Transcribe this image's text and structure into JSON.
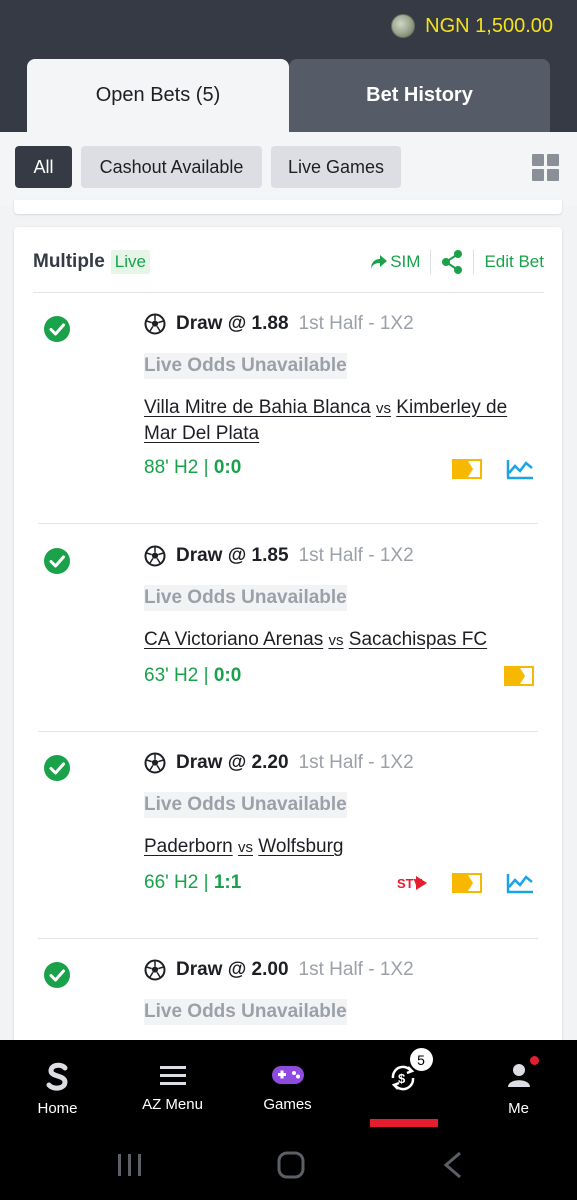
{
  "header": {
    "balance": "NGN 1,500.00",
    "tabs": [
      {
        "label": "Open Bets (5)",
        "active": true
      },
      {
        "label": "Bet History",
        "active": false
      }
    ]
  },
  "filters": {
    "chips": [
      "All",
      "Cashout Available",
      "Live Games"
    ],
    "active": "All",
    "layout_icon": "grid-icon"
  },
  "bet": {
    "type": "Multiple",
    "live_label": "Live",
    "sim_label": "SIM",
    "edit_label": "Edit Bet",
    "selections": [
      {
        "pick": "Draw @ 1.88",
        "market": "1st Half - 1X2",
        "odds_status": "Live Odds Unavailable",
        "home": "Villa Mitre de Bahia Blanca",
        "away": "Kimberley de Mar Del Plata",
        "vs": "vs",
        "time": "88' H2 | ",
        "score": "0:0",
        "icons": [
          "live-match-tracker-icon",
          "stats-icon"
        ]
      },
      {
        "pick": "Draw @ 1.85",
        "market": "1st Half - 1X2",
        "odds_status": "Live Odds Unavailable",
        "home": "CA Victoriano Arenas",
        "away": "Sacachispas FC",
        "vs": "vs",
        "time": "63' H2 | ",
        "score": "0:0",
        "icons": [
          "live-match-tracker-icon"
        ]
      },
      {
        "pick": "Draw @ 2.20",
        "market": "1st Half - 1X2",
        "odds_status": "Live Odds Unavailable",
        "home": "Paderborn",
        "away": "Wolfsburg",
        "vs": "vs",
        "time": "66' H2 | ",
        "score": "1:1",
        "icons": [
          "stv-icon",
          "live-match-tracker-icon",
          "stats-icon"
        ]
      },
      {
        "pick": "Draw @ 2.00",
        "market": "1st Half - 1X2",
        "odds_status": "Live Odds Unavailable"
      }
    ]
  },
  "bottom_nav": {
    "items": [
      {
        "label": "Home",
        "icon": "sporty-logo-icon"
      },
      {
        "label": "AZ Menu",
        "icon": "menu-icon"
      },
      {
        "label": "Games",
        "icon": "gamepad-icon"
      },
      {
        "label": "",
        "icon": "open-bets-icon",
        "badge": "5"
      },
      {
        "label": "Me",
        "icon": "user-icon"
      }
    ]
  },
  "colors": {
    "header_bg": "#353a45",
    "balance": "#f5e21a",
    "green": "#19a24a",
    "yellow_icon": "#f6b800",
    "blue_icon": "#1aa3e8",
    "red": "#e41e2e"
  }
}
